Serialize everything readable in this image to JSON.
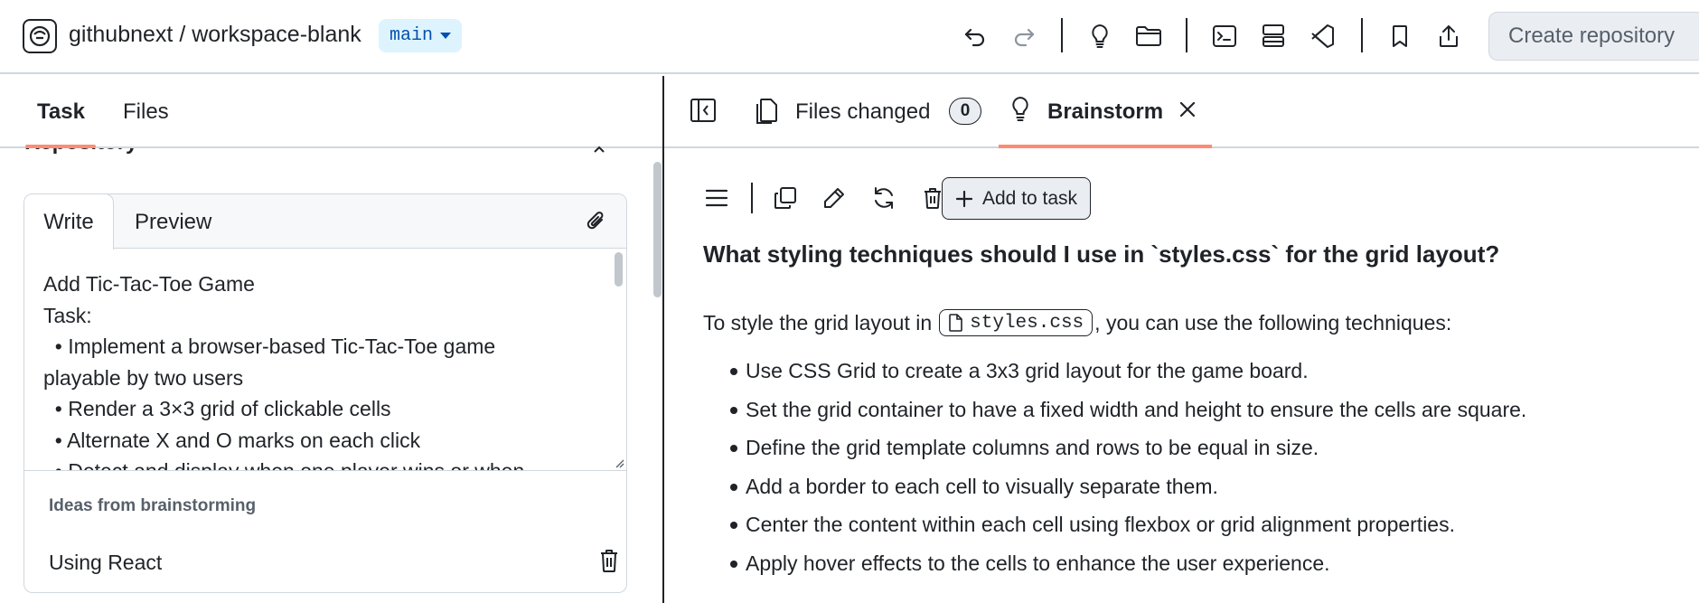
{
  "header": {
    "repo": "githubnext / workspace-blank",
    "branch": "main",
    "create_button": "Create repository",
    "icons": [
      "github-copilot-logo",
      "undo-icon",
      "redo-icon",
      "lightbulb-icon",
      "folder-icon",
      "terminal-icon",
      "server-icon",
      "vscode-icon",
      "bookmark-icon",
      "share-icon"
    ]
  },
  "left": {
    "tabs": [
      "Task",
      "Files"
    ],
    "section_heading": "Repository",
    "editor": {
      "tab_write": "Write",
      "tab_preview": "Preview",
      "lines": [
        "Add Tic-Tac-Toe Game",
        "Task:",
        "  • Implement a browser-based Tic-Tac-Toe game",
        "playable by two users",
        "  • Render a 3×3 grid of clickable cells",
        "  • Alternate X and O marks on each click",
        "  • Detect and display when one player wins or when"
      ]
    },
    "ideas_title": "Ideas from brainstorming",
    "ideas": [
      "Using React"
    ]
  },
  "right": {
    "tabs": {
      "files_changed": "Files changed",
      "files_changed_count": "0",
      "brainstorm": "Brainstorm"
    },
    "toolbar": {
      "add_to_task": "Add to task"
    },
    "question": "What styling techniques should I use in `styles.css` for the grid layout?",
    "intro_before": "To style the grid layout in",
    "intro_file": "styles.css",
    "intro_after": ", you can use the following techniques:",
    "bullets": [
      "Use CSS Grid to create a 3x3 grid layout for the game board.",
      "Set the grid container to have a fixed width and height to ensure the cells are square.",
      "Define the grid template columns and rows to be equal in size.",
      "Add a border to each cell to visually separate them.",
      "Center the content within each cell using flexbox or grid alignment properties.",
      "Apply hover effects to the cells to enhance the user experience."
    ]
  },
  "colors": {
    "accent_underline": "#fd8c73",
    "branch_bg": "#ddf4ff",
    "branch_text": "#0550ae",
    "border": "#d0d7de"
  }
}
